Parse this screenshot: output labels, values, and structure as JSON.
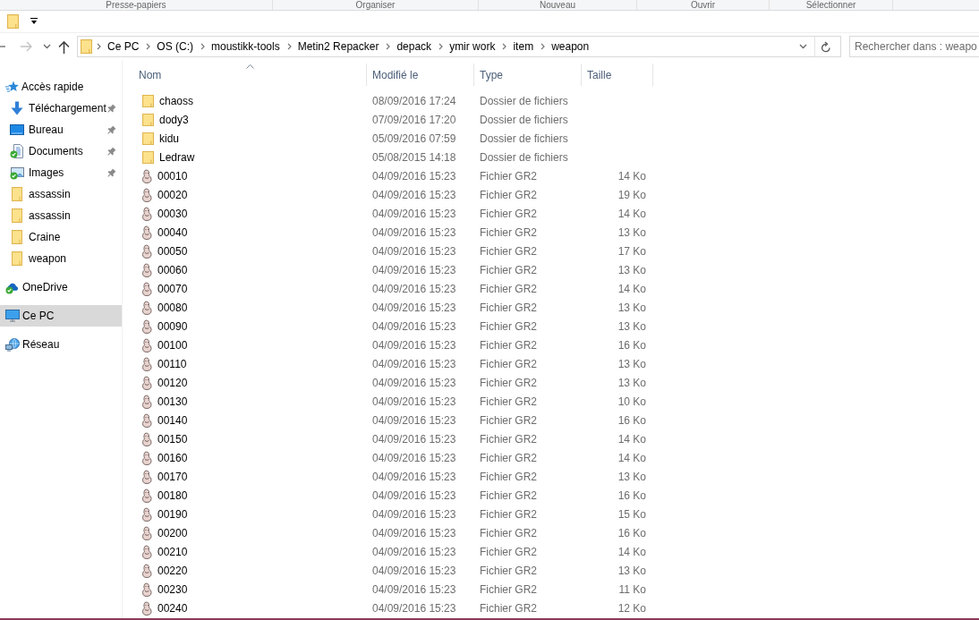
{
  "ribbon_groups": [
    "Presse-papiers",
    "Organiser",
    "Nouveau",
    "Ouvrir",
    "Sélectionner"
  ],
  "address_bar": {
    "path": [
      "Ce PC",
      "OS (C:)",
      "moustikk-tools",
      "Metin2 Repacker",
      "depack",
      "ymir work",
      "item",
      "weapon"
    ]
  },
  "search": {
    "placeholder": "Rechercher dans : weapo"
  },
  "sidebar": {
    "items": [
      {
        "label": "Accès rapide",
        "kind": "quick-access",
        "selected": false,
        "children": [
          {
            "label": "Téléchargement",
            "kind": "downloads",
            "pinned": true,
            "selected": false
          },
          {
            "label": "Bureau",
            "kind": "desktop",
            "pinned": true,
            "selected": false
          },
          {
            "label": "Documents",
            "kind": "documents",
            "pinned": true,
            "selected": false
          },
          {
            "label": "Images",
            "kind": "pictures",
            "pinned": true,
            "selected": false
          },
          {
            "label": "assassin",
            "kind": "folder",
            "pinned": false,
            "selected": false
          },
          {
            "label": "assassin",
            "kind": "folder",
            "pinned": false,
            "selected": false
          },
          {
            "label": "Craine",
            "kind": "folder",
            "pinned": false,
            "selected": false
          },
          {
            "label": "weapon",
            "kind": "folder",
            "pinned": false,
            "selected": false
          }
        ]
      },
      {
        "label": "OneDrive",
        "kind": "onedrive",
        "selected": false
      },
      {
        "label": "Ce PC",
        "kind": "pc",
        "selected": true
      },
      {
        "label": "Réseau",
        "kind": "network",
        "selected": false
      }
    ]
  },
  "file_list": {
    "columns": [
      {
        "label": "Nom",
        "sorted": true
      },
      {
        "label": "Modifié le",
        "sorted": false
      },
      {
        "label": "Type",
        "sorted": false
      },
      {
        "label": "Taille",
        "sorted": false
      }
    ],
    "rows": [
      {
        "kind": "folder",
        "name": "chaoss",
        "modified": "08/09/2016 17:24",
        "type": "Dossier de fichiers"
      },
      {
        "kind": "folder",
        "name": "dody3",
        "modified": "07/09/2016 17:20",
        "type": "Dossier de fichiers"
      },
      {
        "kind": "folder",
        "name": "kidu",
        "modified": "05/09/2016 07:59",
        "type": "Dossier de fichiers"
      },
      {
        "kind": "folder",
        "name": "Ledraw",
        "modified": "05/08/2015 14:18",
        "type": "Dossier de fichiers"
      },
      {
        "kind": "file",
        "name": "00010",
        "modified": "04/09/2016 15:23",
        "type": "Fichier GR2",
        "size": "14 Ko"
      },
      {
        "kind": "file",
        "name": "00020",
        "modified": "04/09/2016 15:23",
        "type": "Fichier GR2",
        "size": "19 Ko"
      },
      {
        "kind": "file",
        "name": "00030",
        "modified": "04/09/2016 15:23",
        "type": "Fichier GR2",
        "size": "14 Ko"
      },
      {
        "kind": "file",
        "name": "00040",
        "modified": "04/09/2016 15:23",
        "type": "Fichier GR2",
        "size": "13 Ko"
      },
      {
        "kind": "file",
        "name": "00050",
        "modified": "04/09/2016 15:23",
        "type": "Fichier GR2",
        "size": "17 Ko"
      },
      {
        "kind": "file",
        "name": "00060",
        "modified": "04/09/2016 15:23",
        "type": "Fichier GR2",
        "size": "13 Ko"
      },
      {
        "kind": "file",
        "name": "00070",
        "modified": "04/09/2016 15:23",
        "type": "Fichier GR2",
        "size": "14 Ko"
      },
      {
        "kind": "file",
        "name": "00080",
        "modified": "04/09/2016 15:23",
        "type": "Fichier GR2",
        "size": "13 Ko"
      },
      {
        "kind": "file",
        "name": "00090",
        "modified": "04/09/2016 15:23",
        "type": "Fichier GR2",
        "size": "13 Ko"
      },
      {
        "kind": "file",
        "name": "00100",
        "modified": "04/09/2016 15:23",
        "type": "Fichier GR2",
        "size": "16 Ko"
      },
      {
        "kind": "file",
        "name": "00110",
        "modified": "04/09/2016 15:23",
        "type": "Fichier GR2",
        "size": "13 Ko"
      },
      {
        "kind": "file",
        "name": "00120",
        "modified": "04/09/2016 15:23",
        "type": "Fichier GR2",
        "size": "13 Ko"
      },
      {
        "kind": "file",
        "name": "00130",
        "modified": "04/09/2016 15:23",
        "type": "Fichier GR2",
        "size": "10 Ko"
      },
      {
        "kind": "file",
        "name": "00140",
        "modified": "04/09/2016 15:23",
        "type": "Fichier GR2",
        "size": "16 Ko"
      },
      {
        "kind": "file",
        "name": "00150",
        "modified": "04/09/2016 15:23",
        "type": "Fichier GR2",
        "size": "14 Ko"
      },
      {
        "kind": "file",
        "name": "00160",
        "modified": "04/09/2016 15:23",
        "type": "Fichier GR2",
        "size": "14 Ko"
      },
      {
        "kind": "file",
        "name": "00170",
        "modified": "04/09/2016 15:23",
        "type": "Fichier GR2",
        "size": "13 Ko"
      },
      {
        "kind": "file",
        "name": "00180",
        "modified": "04/09/2016 15:23",
        "type": "Fichier GR2",
        "size": "16 Ko"
      },
      {
        "kind": "file",
        "name": "00190",
        "modified": "04/09/2016 15:23",
        "type": "Fichier GR2",
        "size": "15 Ko"
      },
      {
        "kind": "file",
        "name": "00200",
        "modified": "04/09/2016 15:23",
        "type": "Fichier GR2",
        "size": "16 Ko"
      },
      {
        "kind": "file",
        "name": "00210",
        "modified": "04/09/2016 15:23",
        "type": "Fichier GR2",
        "size": "14 Ko"
      },
      {
        "kind": "file",
        "name": "00220",
        "modified": "04/09/2016 15:23",
        "type": "Fichier GR2",
        "size": "13 Ko"
      },
      {
        "kind": "file",
        "name": "00230",
        "modified": "04/09/2016 15:23",
        "type": "Fichier GR2",
        "size": "11 Ko"
      },
      {
        "kind": "file",
        "name": "00240",
        "modified": "04/09/2016 15:23",
        "type": "Fichier GR2",
        "size": "12 Ko"
      }
    ]
  }
}
